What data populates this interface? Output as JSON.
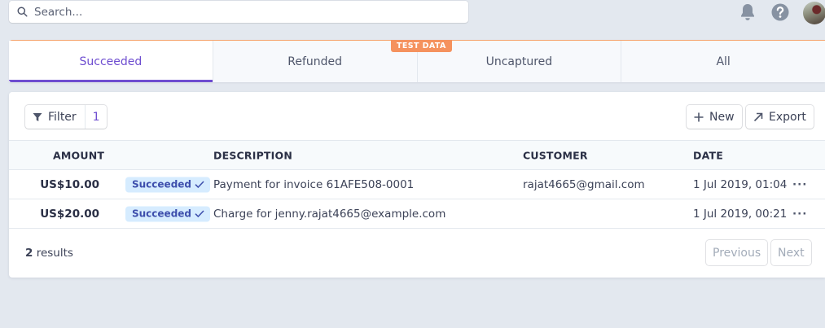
{
  "search": {
    "placeholder": "Search..."
  },
  "tabs": [
    {
      "label": "Succeeded",
      "active": true
    },
    {
      "label": "Refunded",
      "active": false
    },
    {
      "label": "Uncaptured",
      "active": false
    },
    {
      "label": "All",
      "active": false
    }
  ],
  "test_badge": "TEST DATA",
  "toolbar": {
    "filter_label": "Filter",
    "filter_count": "1",
    "new_label": "New",
    "export_label": "Export"
  },
  "table": {
    "columns": [
      "AMOUNT",
      "DESCRIPTION",
      "CUSTOMER",
      "DATE"
    ],
    "rows": [
      {
        "amount": "US$10.00",
        "status": "Succeeded",
        "description": "Payment for invoice 61AFE508-0001",
        "customer": "rajat4665@gmail.com",
        "date": "1 Jul 2019, 01:04"
      },
      {
        "amount": "US$20.00",
        "status": "Succeeded",
        "description": "Charge for jenny.rajat4665@example.com",
        "customer": "",
        "date": "1 Jul 2019, 00:21"
      }
    ]
  },
  "footer": {
    "results_count": "2",
    "results_word": "results",
    "previous_label": "Previous",
    "next_label": "Next"
  },
  "colors": {
    "accent": "#6e4dd0",
    "test_orange": "#f5925e",
    "pill_bg": "#d6ecff",
    "pill_text": "#3d4eac",
    "page_bg": "#e3e8ef"
  },
  "icons": {
    "search": "search-icon",
    "bell": "bell-icon",
    "help": "help-icon",
    "filter": "filter-icon",
    "plus": "plus-icon",
    "export": "arrow-up-right-icon",
    "check": "check-icon",
    "more": "more-icon"
  }
}
